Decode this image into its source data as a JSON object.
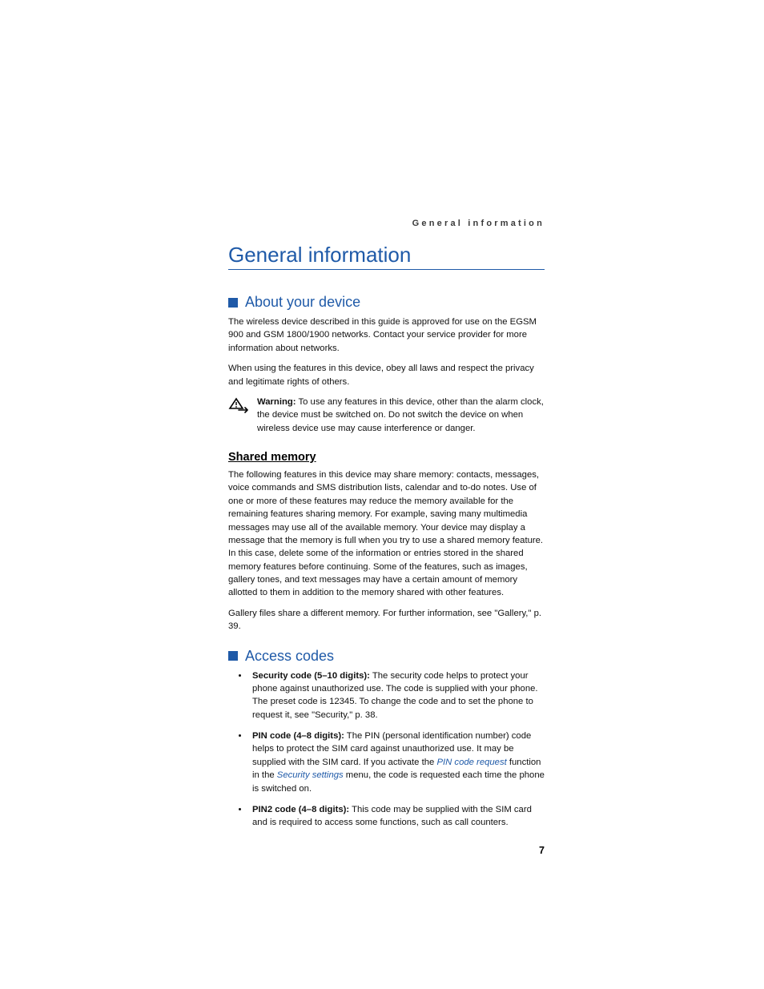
{
  "header": {
    "running": "General information"
  },
  "chapter": {
    "title": "General information"
  },
  "section_about": {
    "title": "About your device",
    "p1": "The wireless device described in this guide is approved for use on the EGSM 900 and GSM 1800/1900 networks. Contact your service provider for more information about networks.",
    "p2": "When using the features in this device, obey all laws and respect the privacy and legitimate rights of others.",
    "warning_label": "Warning:",
    "warning_text": " To use any features in this device, other than the alarm clock, the device must be switched on. Do not switch the device on when wireless device use may cause interference or danger."
  },
  "sub_shared": {
    "title": "Shared memory",
    "p1": "The following features in this device may share memory: contacts, messages, voice commands and SMS distribution lists, calendar and to-do notes. Use of one or more of these features may reduce the memory available for the remaining features sharing memory. For example, saving many multimedia messages may use all of the available memory. Your device may display a message that the memory is full when you try to use a shared memory feature. In this case, delete some of the information or entries stored in the shared memory features before continuing. Some of the features, such as images, gallery tones, and text messages may have a certain amount of memory allotted to them in addition to the memory shared with other features.",
    "p2": "Gallery files share a different memory. For further information, see \"Gallery,\" p. 39."
  },
  "section_codes": {
    "title": "Access codes",
    "items": [
      {
        "label": "Security code (5–10 digits):",
        "text": " The security code helps to protect your phone against unauthorized use. The code is supplied with your phone. The preset code is 12345. To change the code and to set the phone to request it, see \"Security,\" p. 38."
      },
      {
        "label": "PIN code (4–8 digits):",
        "pre": " The PIN (personal identification number) code helps to protect the SIM card against unauthorized use. It may be supplied with the SIM card. If you activate the ",
        "link1": "PIN code request",
        "mid": " function in the ",
        "link2": "Security settings",
        "post": " menu, the code is requested each time the phone is switched on."
      },
      {
        "label": "PIN2 code (4–8 digits):",
        "text": " This code may be supplied with the SIM card and is required to access some functions, such as call counters."
      }
    ]
  },
  "page_number": "7"
}
